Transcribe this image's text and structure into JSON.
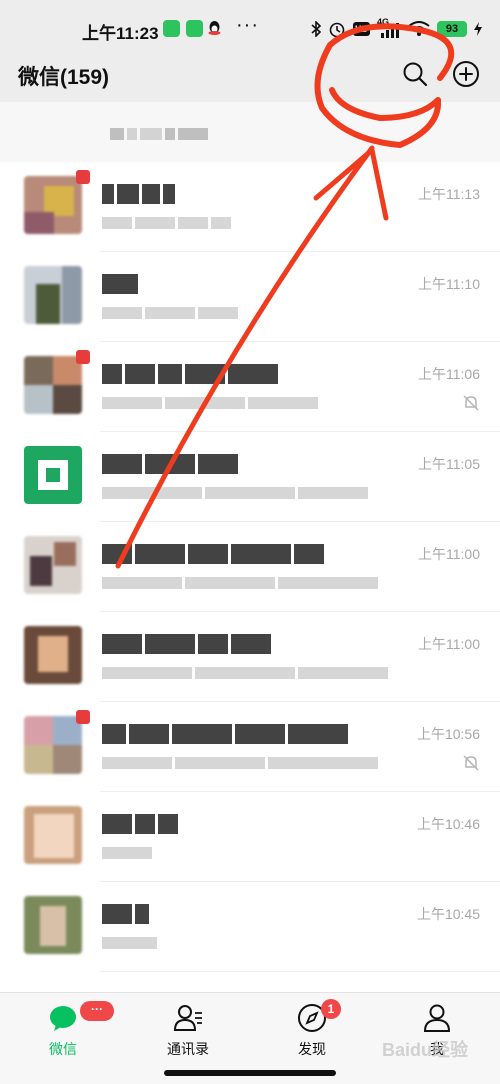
{
  "status_bar": {
    "time": "上午11:23",
    "network": "4G",
    "hd": "HD",
    "battery": "93",
    "more": "···"
  },
  "header": {
    "title": "微信(159)",
    "search_icon": "search-icon",
    "add_icon": "add-circle-icon"
  },
  "chats": [
    {
      "time": "上午11:13",
      "muted": false
    },
    {
      "time": "上午11:10",
      "muted": false
    },
    {
      "time": "上午11:06",
      "muted": true
    },
    {
      "time": "上午11:05",
      "muted": false
    },
    {
      "time": "上午11:00",
      "muted": false
    },
    {
      "time": "上午11:00",
      "muted": false
    },
    {
      "time": "上午10:56",
      "muted": true
    },
    {
      "time": "上午10:46",
      "muted": false
    },
    {
      "time": "上午10:45",
      "muted": false
    }
  ],
  "bottom_nav": {
    "items": [
      {
        "label": "微信",
        "icon": "chat-bubble-icon",
        "badge": "···",
        "active": true
      },
      {
        "label": "通讯录",
        "icon": "contacts-icon",
        "badge": "",
        "active": false
      },
      {
        "label": "发现",
        "icon": "compass-icon",
        "badge": "1",
        "active": false
      },
      {
        "label": "我",
        "icon": "person-icon",
        "badge": "",
        "active": false
      }
    ]
  },
  "watermark": "Baidu经验",
  "colors": {
    "accent": "#07c160",
    "badge": "#f04848",
    "annotation": "#f03c1e",
    "header_bg": "#ededed"
  }
}
